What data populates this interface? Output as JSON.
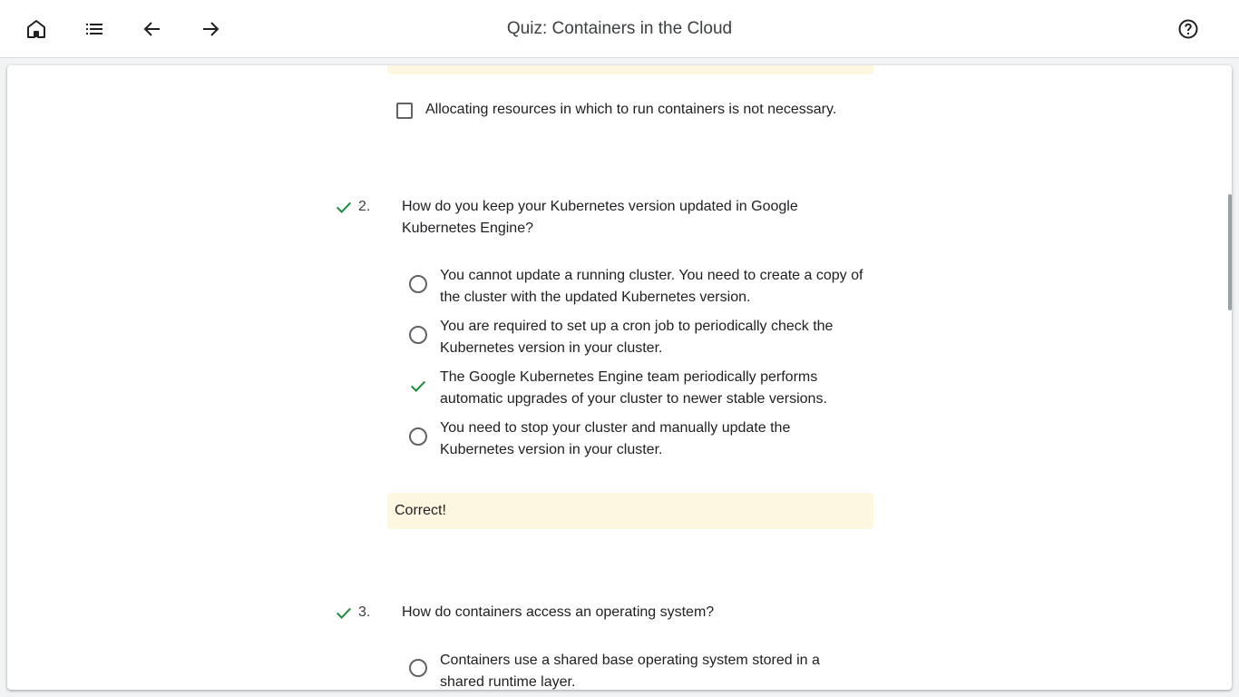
{
  "header": {
    "title": "Quiz: Containers in the Cloud",
    "icons": [
      "home-icon",
      "list-icon",
      "arrow-back-icon",
      "arrow-forward-icon",
      "help-icon"
    ]
  },
  "q1": {
    "last_option": "Allocating resources in which to run containers is not necessary."
  },
  "q2": {
    "number": "2.",
    "text": "How do you keep your Kubernetes version updated in Google Kubernetes Engine?",
    "options": [
      "You cannot update a running cluster. You need to create a copy of the cluster with the updated Kubernetes version.",
      "You are required to set up a cron job to periodically check the Kubernetes version in your cluster.",
      "The Google Kubernetes Engine team periodically performs automatic upgrades of your cluster to newer stable versions.",
      "You need to stop your cluster and manually update the Kubernetes version in your cluster."
    ],
    "feedback": "Correct!"
  },
  "q3": {
    "number": "3.",
    "text": "How do containers access an operating system?",
    "options": [
      "Containers use a shared base operating system stored in a shared runtime layer."
    ]
  },
  "colors": {
    "correct": "#1e8e3e",
    "feedback_bg": "#fef7e0"
  }
}
